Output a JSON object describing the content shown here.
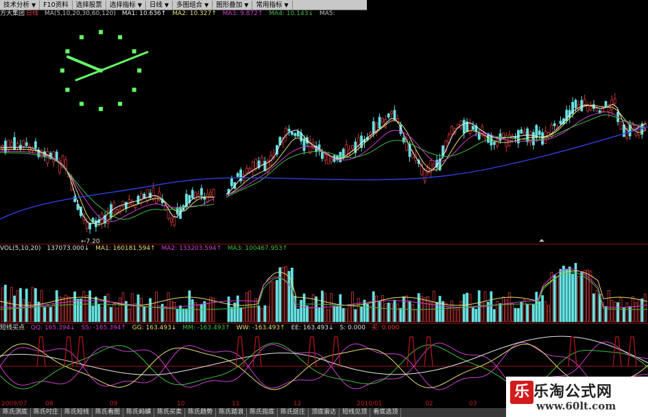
{
  "toolbar": {
    "items": [
      "技术分析",
      "F10资料",
      "选择股票",
      "选择指标",
      "日线",
      "多图组合",
      "图形叠加",
      "常用指标"
    ]
  },
  "main_info": {
    "stock": "方大集团",
    "period": "日线",
    "ma_params": "MA(5,10,20,30,60,120)",
    "ma1": "MA1: 10.636↑",
    "ma2": "MA2: 10.327↑",
    "ma3": "MA3: 9.872↑",
    "ma4": "MA4: 10.143↓",
    "ma5": "MA5:"
  },
  "low_label": "←7.20",
  "vol_info": {
    "name": "VOL(5,10,20)",
    "vol": "137073.000↓",
    "ma1": "MA1: 160181.594↑",
    "ma2": "MA2: 133203.594↑",
    "ma3": "MA3: 100467.953↑"
  },
  "ind_info": {
    "name": "短线买点",
    "qq": "QQ: 165.394↓",
    "ss": "SS: -165.394↑",
    "gg": "GG: 163.493↓",
    "mm": "MM: -163.493↑",
    "ww": "WW: -163.493↑",
    "ee": "EE: 163.493↓",
    "s": "S: 0.000",
    "buy": "买: 0.000"
  },
  "dates": [
    "2009/07",
    "08",
    "09",
    "10",
    "11",
    "12",
    "2010/01",
    "02",
    "03"
  ],
  "bottom_tabs": [
    "陈氏测底",
    "陈氏吋庄",
    "陈氏短线",
    "陈氏看图",
    "陈氏蚂蟥",
    "陈氏买卖",
    "陈氏趋势",
    "陈氏踏浪",
    "陈氏指底",
    "陈氏捉庄",
    "顶底雷达",
    "短线见顶",
    "看底选顶"
  ],
  "watermark": {
    "logo": "乐",
    "title": "乐淘公式网",
    "url": "www.60lt.com"
  },
  "colors": {
    "up": "#d23a3a",
    "down": "#66e0e0",
    "ma_white": "#f0f0f0",
    "ma_yellow": "#e8e070",
    "ma_purple": "#d040d0",
    "ma_green": "#40c040",
    "ma_blue": "#3040e0",
    "clock": "#66ff66"
  }
}
